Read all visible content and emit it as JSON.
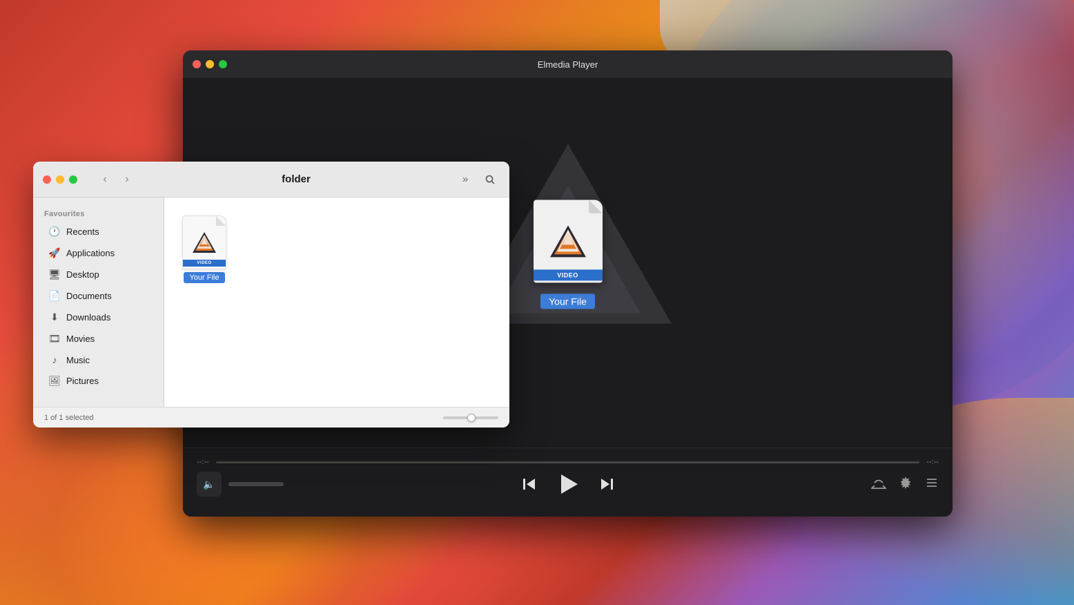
{
  "desktop": {
    "bg_description": "macOS Big Sur wallpaper gradient"
  },
  "player": {
    "title": "Elmedia Player",
    "traffic_lights": [
      "close",
      "minimize",
      "maximize"
    ],
    "file_label": "VIDEO",
    "file_name": "Your File",
    "time_start": "--:--",
    "time_end": "--:--",
    "controls": {
      "prev_label": "⏮",
      "play_label": "▶",
      "next_label": "⏭"
    }
  },
  "finder": {
    "title": "folder",
    "traffic_lights": [
      "close",
      "minimize",
      "maximize"
    ],
    "sidebar": {
      "section": "Favourites",
      "items": [
        {
          "label": "Recents",
          "icon": "clock"
        },
        {
          "label": "Applications",
          "icon": "rocket"
        },
        {
          "label": "Desktop",
          "icon": "monitor"
        },
        {
          "label": "Documents",
          "icon": "doc"
        },
        {
          "label": "Downloads",
          "icon": "download"
        },
        {
          "label": "Movies",
          "icon": "film"
        },
        {
          "label": "Music",
          "icon": "music"
        },
        {
          "label": "Pictures",
          "icon": "photo"
        }
      ]
    },
    "file": {
      "type_badge": "VIDEO",
      "name": "Your File"
    },
    "status": "1 of 1 selected"
  }
}
